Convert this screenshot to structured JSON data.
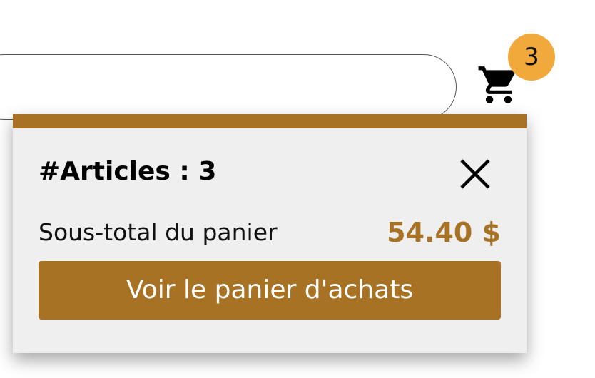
{
  "cart": {
    "icon": "shopping-cart-icon",
    "badge_count": "3"
  },
  "popup": {
    "title": "#Articles : 3",
    "close_icon": "close-icon",
    "subtotal_label": "Sous-total du panier",
    "subtotal_value": "54.40 $",
    "view_cart_label": "Voir le panier d'achats"
  },
  "colors": {
    "accent": "#a87225",
    "badge": "#f2a93b",
    "panel_bg": "#efefef"
  }
}
